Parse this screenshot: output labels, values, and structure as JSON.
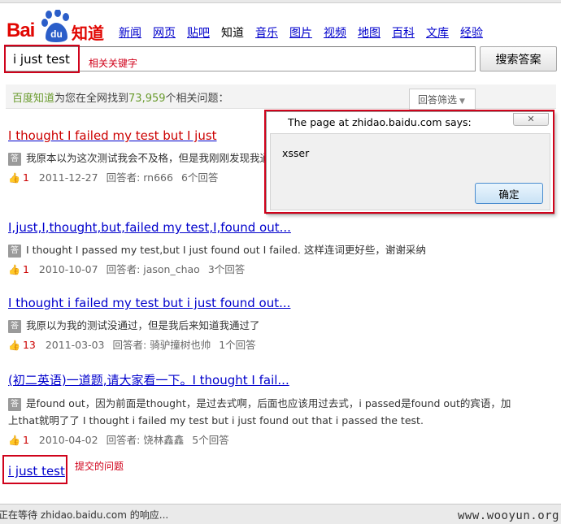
{
  "header": {
    "logo_bai": "Bai",
    "logo_du": "du",
    "logo_zhidao": "知道",
    "nav": [
      "新闻",
      "网页",
      "贴吧",
      "知道",
      "音乐",
      "图片",
      "视频",
      "地图",
      "百科",
      "文库",
      "经验"
    ],
    "nav_current_index": 3
  },
  "search": {
    "value": "i just test",
    "button_label": "搜索答案"
  },
  "annotations": {
    "keyword_note": "相关关键字",
    "submitted_note": "提交的问题"
  },
  "summary": {
    "brand": "百度知道",
    "prefix": "为您在全网找到",
    "count": "73,959",
    "suffix": "个相关问题："
  },
  "filter": {
    "label": "回答筛选",
    "caret": "▼"
  },
  "results": [
    {
      "title": "I thought I failed my test but I just",
      "snippet": "我原本以为这次测试我会不及格，但是我刚刚发现我通过了 dv. 刚刚, 仅仅, 正好，经常用于一般过去式",
      "likes": "1",
      "date": "2011-12-27",
      "answerer_label": "回答者:",
      "answerer": "rn666",
      "answers": "6个回答"
    },
    {
      "title": "I,just,I,thought,but,failed my test,I,found out...",
      "snippet": "I thought I passed my test,but I just found out I failed. 这样连词更好些，谢谢采纳",
      "likes": "1",
      "date": "2010-10-07",
      "answerer_label": "回答者:",
      "answerer": "jason_chao",
      "answers": "3个回答"
    },
    {
      "title": "I thought i failed my test but i just found out...",
      "snippet": "我原以为我的测试没通过，但是我后来知道我通过了",
      "likes": "13",
      "date": "2011-03-03",
      "answerer_label": "回答者:",
      "answerer": "骑驴撞树也帅",
      "answers": "1个回答"
    },
    {
      "title": "(初二英语)一道题,请大家看一下。I thought I fail...",
      "snippet": "是found out，因为前面是thought，是过去式啊，后面也应该用过去式，i passed是found out的宾语，加上that就明了了 I thought i failed my test but i just found out that i passed the test.",
      "likes": "1",
      "date": "2010-04-02",
      "answerer_label": "回答者:",
      "answerer": "饶林鑫鑫",
      "answers": "5个回答"
    }
  ],
  "final_link": "i just test",
  "dialog": {
    "title": "The page at zhidao.baidu.com says:",
    "message": "xsser",
    "ok_label": "确定",
    "close_glyph": "✕"
  },
  "status": {
    "text": "正在等待 zhidao.baidu.com 的响应..."
  },
  "watermark": "www.wooyun.org",
  "colors": {
    "baidu_red": "#e10602",
    "link_blue": "#0000cc",
    "highlight_red": "#cc0000",
    "annotation_red": "#d0021b",
    "brand_green": "#6a9b2e"
  }
}
